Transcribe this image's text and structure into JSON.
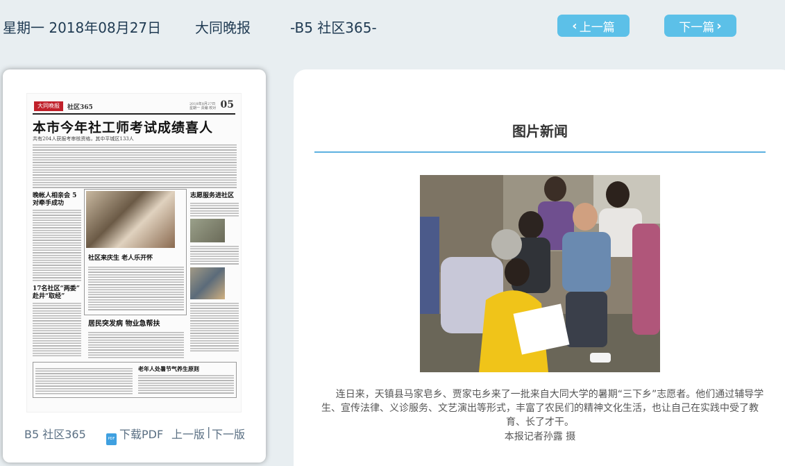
{
  "header": {
    "date": "星期一 2018年08月27日",
    "paper_name": "大同晚报",
    "section": "-B5 社区365-",
    "prev_label": "上一篇",
    "next_label": "下一篇"
  },
  "page_thumb": {
    "logo": "大同晚报",
    "section": "社区365",
    "page_num": "05",
    "info": "2018年8月27日 星期一 责编 校对",
    "headline": "本市今年社工师考试成绩喜人",
    "subhead": "共有204人获报考审核资格，其中平城区133人",
    "articles": [
      "晚帐人相亲会 5对牵手成功",
      "社区来庆生 老人乐开怀",
      "志愿服务进社区",
      "17名社区“两委” 赴井“取经”",
      "居民突发病 物业急帮扶",
      "老年人处暑节气养生原则"
    ]
  },
  "bottom_links": {
    "page": "B5 社区365",
    "pdf_icon": "pdf-icon",
    "download": "下载PDF",
    "prev_page": "上一版",
    "separator": "|",
    "next_page": "下一版"
  },
  "article": {
    "title": "图片新闻",
    "caption": "连日来，天镇县马家皂乡、贾家屯乡来了一批来自大同大学的暑期“三下乡”志愿者。他们通过辅导学生、宣传法律、义诊服务、文艺演出等形式，丰富了农民们的精神文化生活，也让自己在实践中受了教育、长了才干。",
    "credit": "本报记者孙露 摄"
  },
  "colors": {
    "accent": "#5cc0e8",
    "page_bg": "#e8eef1",
    "title_line": "#5cb0e0"
  }
}
